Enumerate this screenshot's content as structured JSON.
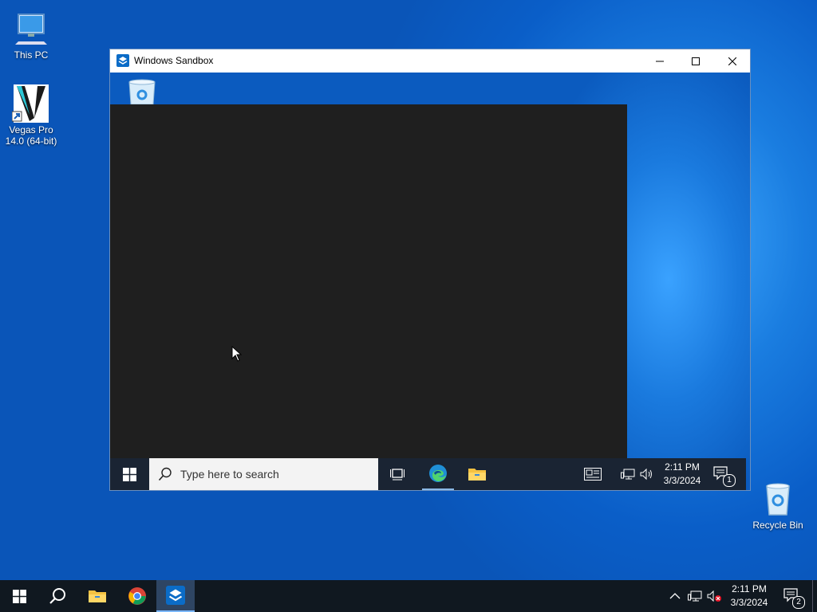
{
  "desktop": {
    "icons": [
      {
        "label": "This PC"
      },
      {
        "label": "Vegas Pro 14.0 (64-bit)"
      },
      {
        "label": "Recycle Bin"
      }
    ]
  },
  "sandbox": {
    "title": "Windows Sandbox",
    "search_placeholder": "Type here to search",
    "clock_time": "2:11 PM",
    "clock_date": "3/3/2024",
    "notifications_count": "1"
  },
  "taskbar": {
    "clock_time": "2:11 PM",
    "clock_date": "3/3/2024",
    "notifications_count": "2"
  },
  "colors": {
    "accent": "#0078d7",
    "console_bg": "#1f1f1f",
    "taskbar_bg": "#101820"
  }
}
